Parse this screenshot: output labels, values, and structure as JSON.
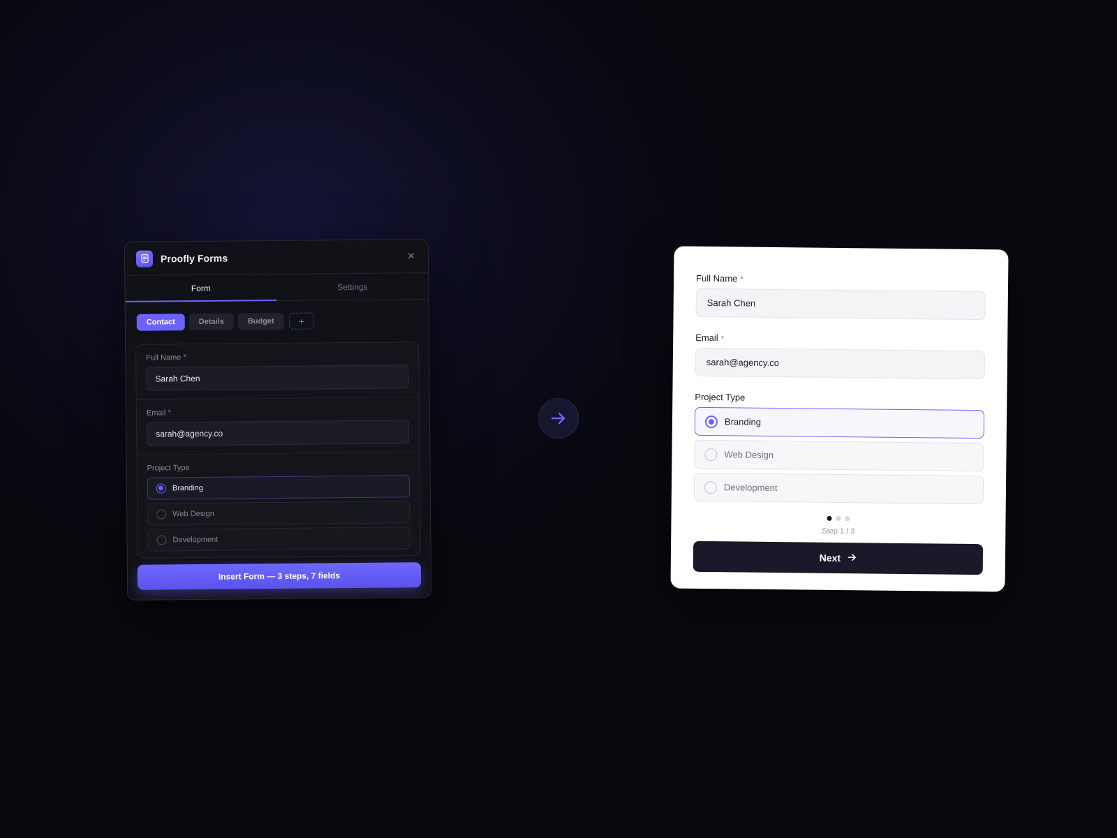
{
  "builder": {
    "title": "Proofly Forms",
    "close_icon": "close-icon",
    "tabs": [
      {
        "label": "Form",
        "active": true
      },
      {
        "label": "Settings",
        "active": false
      }
    ],
    "steps": [
      {
        "label": "Contact",
        "active": true
      },
      {
        "label": "Details",
        "active": false
      },
      {
        "label": "Budget",
        "active": false
      }
    ],
    "add_step_label": "+",
    "fields": {
      "full_name": {
        "label": "Full Name",
        "required_mark": "*",
        "value": "Sarah Chen"
      },
      "email": {
        "label": "Email",
        "required_mark": "*",
        "value": "sarah@agency.co"
      },
      "project_type": {
        "label": "Project Type",
        "options": [
          {
            "label": "Branding",
            "selected": true
          },
          {
            "label": "Web Design",
            "selected": false
          },
          {
            "label": "Development",
            "selected": false
          }
        ]
      }
    },
    "insert_button_label": "Insert Form — 3 steps, 7 fields"
  },
  "center_icon": "arrow-right-icon",
  "preview": {
    "fields": {
      "full_name": {
        "label": "Full Name",
        "required_mark": "*",
        "value": "Sarah Chen"
      },
      "email": {
        "label": "Email",
        "required_mark": "*",
        "value": "sarah@agency.co"
      },
      "project_type": {
        "label": "Project Type",
        "options": [
          {
            "label": "Branding",
            "selected": true
          },
          {
            "label": "Web Design",
            "selected": false
          },
          {
            "label": "Development",
            "selected": false
          }
        ]
      }
    },
    "pagination": {
      "current": 1,
      "total": 3
    },
    "step_text": "Step 1 / 3",
    "next_label": "Next",
    "next_icon": "arrow-right-icon"
  },
  "colors": {
    "accent": "#6c63ff",
    "background": "#0c0c1c",
    "required": "#e0485a"
  }
}
